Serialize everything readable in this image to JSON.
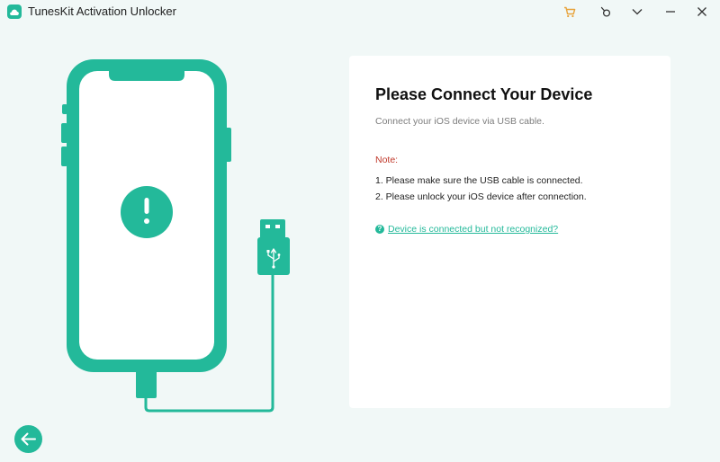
{
  "app": {
    "title": "TunesKit Activation Unlocker",
    "accent_color": "#23b99a",
    "cart_color": "#e8a33c"
  },
  "titlebar_icons": [
    "cart-icon",
    "feedback-icon",
    "menu-chevron-icon",
    "minimize-icon",
    "close-icon"
  ],
  "card": {
    "title": "Please Connect Your Device",
    "subtitle": "Connect your iOS device via USB cable.",
    "note_label": "Note:",
    "notes": [
      "1. Please make sure the USB cable is connected.",
      "2. Please unlock your iOS device after connection."
    ],
    "help_link": "Device is connected but not recognized?",
    "help_icon": "?"
  },
  "illustration": {
    "device_icon": "phone-icon",
    "status_icon": "exclamation-icon",
    "cable_icon": "usb-icon"
  },
  "footer": {
    "back_icon": "back-arrow-icon"
  }
}
